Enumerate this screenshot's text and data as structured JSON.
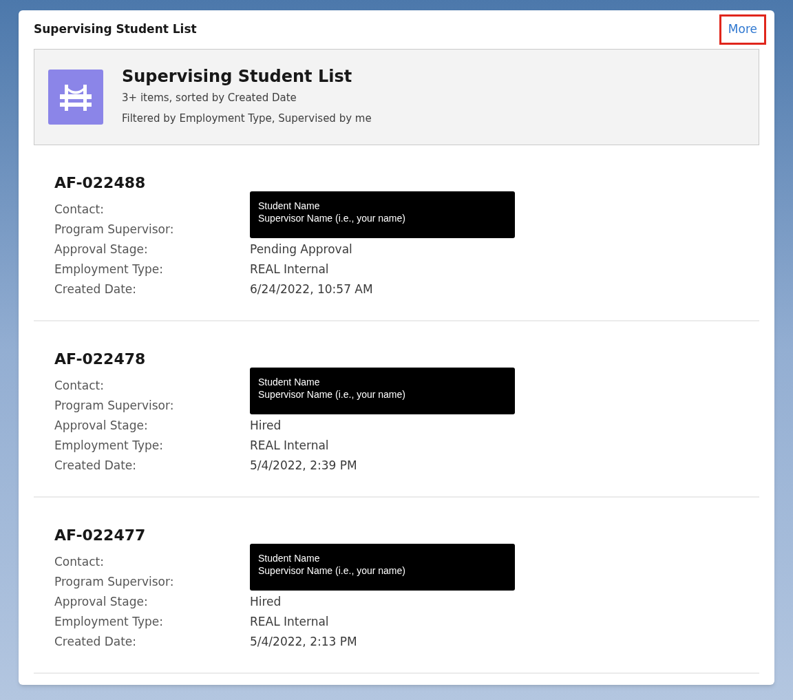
{
  "card": {
    "title": "Supervising Student List",
    "more_link": {
      "label": "More",
      "highlighted": true
    }
  },
  "list_header": {
    "title": "Supervising Student List",
    "summary": "3+ items, sorted by Created Date",
    "filters": "Filtered by Employment Type, Supervised by me"
  },
  "records": [
    {
      "name": "AF-022488",
      "fields": [
        {
          "label": "Contact:"
        },
        {
          "label": "Program Supervisor:"
        },
        {
          "label": "Approval Stage:",
          "value": "Pending Approval"
        },
        {
          "label": "Employment Type:",
          "value": "REAL Internal"
        },
        {
          "label": "Created Date:",
          "value": "6/24/2022, 10:57 AM"
        }
      ],
      "redaction": [
        "Student Name",
        "Supervisor Name (i.e., your name)"
      ]
    },
    {
      "name": "AF-022478",
      "fields": [
        {
          "label": "Contact:"
        },
        {
          "label": "Program Supervisor:"
        },
        {
          "label": "Approval Stage:",
          "value": "Hired"
        },
        {
          "label": "Employment Type:",
          "value": "REAL Internal"
        },
        {
          "label": "Created Date:",
          "value": "5/4/2022, 2:39 PM"
        }
      ],
      "redaction": [
        "Student Name",
        "Supervisor Name (i.e., your name)"
      ]
    },
    {
      "name": "AF-022477",
      "fields": [
        {
          "label": "Contact:"
        },
        {
          "label": "Program Supervisor:"
        },
        {
          "label": "Approval Stage:",
          "value": "Hired"
        },
        {
          "label": "Employment Type:",
          "value": "REAL Internal"
        },
        {
          "label": "Created Date:",
          "value": "5/4/2022, 2:13 PM"
        }
      ],
      "redaction": [
        "Student Name",
        "Supervisor Name (i.e., your name)"
      ]
    }
  ]
}
